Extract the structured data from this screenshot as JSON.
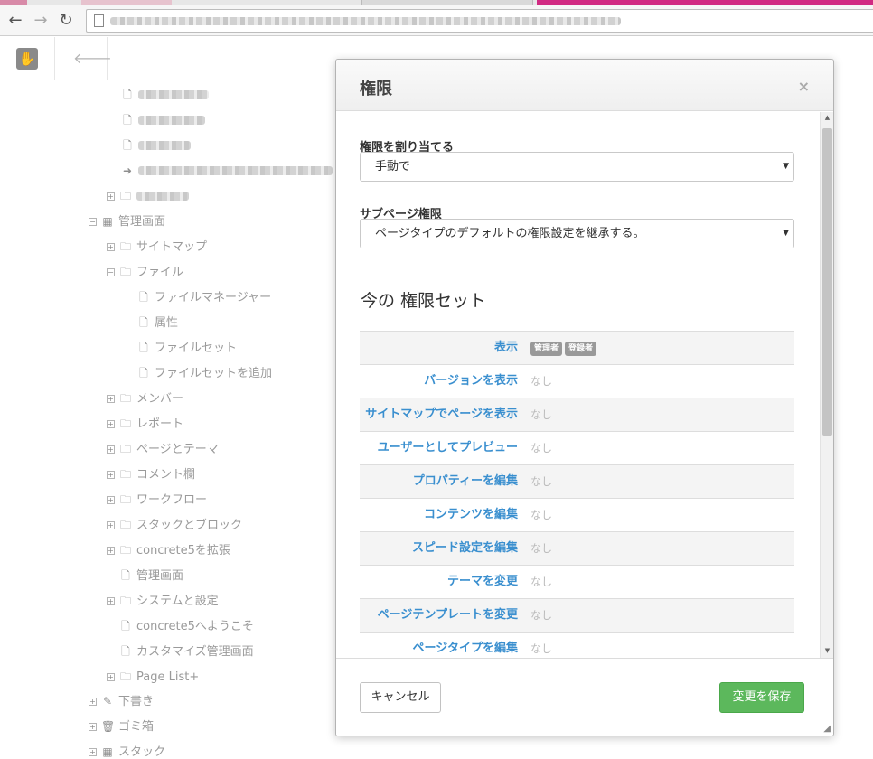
{
  "browser": {
    "back_icon": "back-arrow-icon",
    "forward_icon": "forward-arrow-icon",
    "reload_icon": "reload-icon"
  },
  "sitemap": {
    "items": [
      {
        "label": "管理画面",
        "icon": "grid-icon"
      },
      {
        "label": "サイトマップ",
        "icon": "folder-icon"
      },
      {
        "label": "ファイル",
        "icon": "folder-icon"
      },
      {
        "label": "ファイルマネージャー",
        "icon": "page-icon"
      },
      {
        "label": "属性",
        "icon": "page-icon"
      },
      {
        "label": "ファイルセット",
        "icon": "page-icon"
      },
      {
        "label": "ファイルセットを追加",
        "icon": "page-icon"
      },
      {
        "label": "メンバー",
        "icon": "folder-icon"
      },
      {
        "label": "レポート",
        "icon": "folder-icon"
      },
      {
        "label": "ページとテーマ",
        "icon": "folder-icon"
      },
      {
        "label": "コメント欄",
        "icon": "folder-icon"
      },
      {
        "label": "ワークフロー",
        "icon": "folder-icon"
      },
      {
        "label": "スタックとブロック",
        "icon": "folder-icon"
      },
      {
        "label": "concrete5を拡張",
        "icon": "folder-icon"
      },
      {
        "label": "管理画面",
        "icon": "page-icon"
      },
      {
        "label": "システムと設定",
        "icon": "folder-icon"
      },
      {
        "label": "concrete5へようこそ",
        "icon": "page-icon"
      },
      {
        "label": "カスタマイズ管理画面",
        "icon": "page-icon"
      },
      {
        "label": "Page List+",
        "icon": "folder-icon"
      },
      {
        "label": "下書き",
        "icon": "pencil-icon"
      },
      {
        "label": "ゴミ箱",
        "icon": "trash-icon"
      },
      {
        "label": "スタック",
        "icon": "grid-icon"
      }
    ]
  },
  "modal": {
    "title": "権限",
    "close_label": "×",
    "assign_label": "権限を割り当てる",
    "assign_value": "手動で",
    "subpage_label": "サブページ権限",
    "subpage_value": "ページタイプのデフォルトの権限設定を継承する。",
    "set_heading": "今の 権限セット",
    "permissions": [
      {
        "name": "表示",
        "badges": [
          "管理者",
          "登録者"
        ],
        "value": ""
      },
      {
        "name": "バージョンを表示",
        "badges": [],
        "value": "なし"
      },
      {
        "name": "サイトマップでページを表示",
        "badges": [],
        "value": "なし"
      },
      {
        "name": "ユーザーとしてプレビュー",
        "badges": [],
        "value": "なし"
      },
      {
        "name": "プロパティーを編集",
        "badges": [],
        "value": "なし"
      },
      {
        "name": "コンテンツを編集",
        "badges": [],
        "value": "なし"
      },
      {
        "name": "スピード設定を編集",
        "badges": [],
        "value": "なし"
      },
      {
        "name": "テーマを変更",
        "badges": [],
        "value": "なし"
      },
      {
        "name": "ページテンプレートを変更",
        "badges": [],
        "value": "なし"
      },
      {
        "name": "ページタイプを編集",
        "badges": [],
        "value": "なし"
      }
    ],
    "cancel_label": "キャンセル",
    "save_label": "変更を保存"
  },
  "colors": {
    "link_blue": "#3a8fcf",
    "save_green": "#5cb85c",
    "badge_gray": "#999999"
  }
}
